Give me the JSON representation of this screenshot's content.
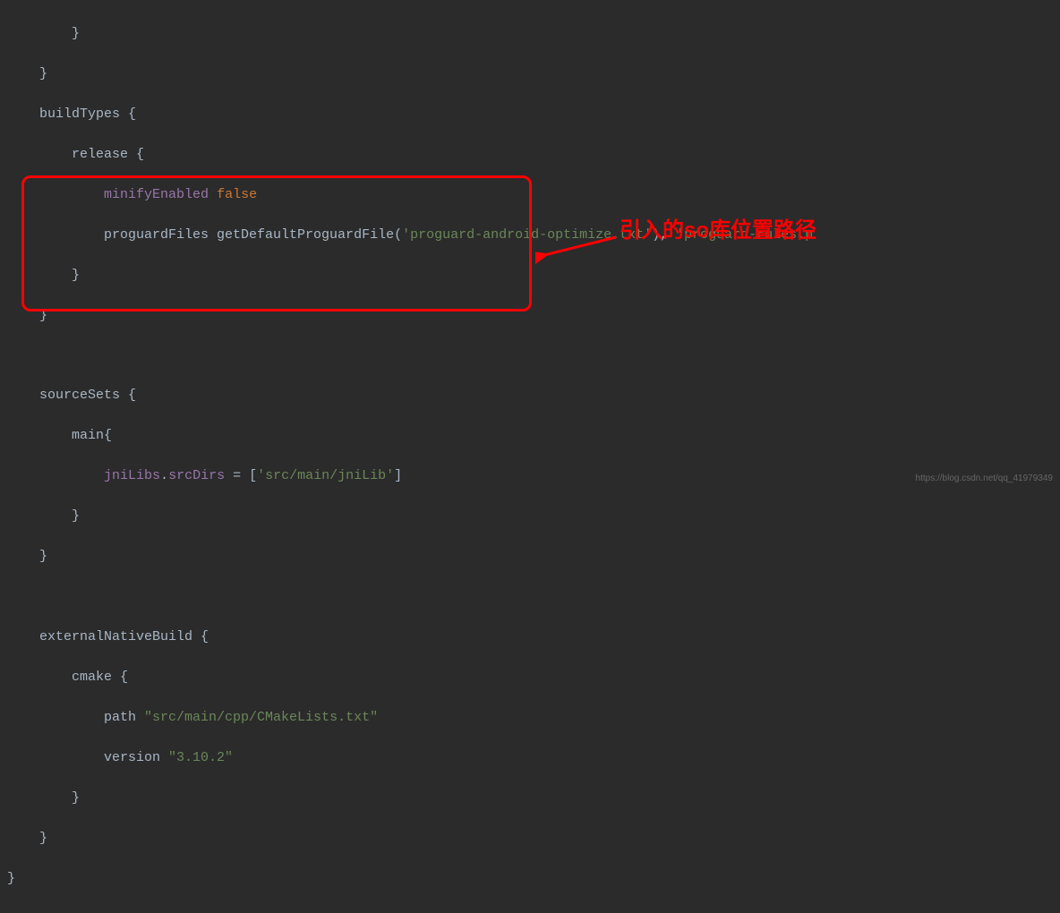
{
  "code": {
    "l1": "        }",
    "l2": "    }",
    "l3_1": "    buildTypes",
    "l3_2": " {",
    "l4_1": "        release",
    "l4_2": " {",
    "l5_1": "            ",
    "l5_prop": "minifyEnabled",
    "l5_sp": " ",
    "l5_bool": "false",
    "l6_1": "            proguardFiles getDefaultProguardFile(",
    "l6_str1": "'proguard-android-optimize.txt'",
    "l6_2": "), ",
    "l6_str2": "'proguard-rules.p",
    "l7": "        }",
    "l8": "    }",
    "l9": "",
    "l10_1": "    sourceSets",
    "l10_2": " {",
    "l11_1": "        main",
    "l11_2": "{",
    "l12_1": "            ",
    "l12_prop": "jniLibs",
    "l12_2": ".",
    "l12_prop2": "srcDirs",
    "l12_3": " = [",
    "l12_str": "'src/main/jniLib'",
    "l12_4": "]",
    "l13": "        }",
    "l14": "    }",
    "l15": "",
    "l16_1": "    externalNativeBuild",
    "l16_2": " {",
    "l17_1": "        cmake",
    "l17_2": " {",
    "l18_1": "            path ",
    "l18_str": "\"src/main/cpp/CMakeLists.txt\"",
    "l19_1": "            version ",
    "l19_str": "\"3.10.2\"",
    "l20": "        }",
    "l21": "    }",
    "l22": "}"
  },
  "annotation": "引入的so库位置路径",
  "watermark": "https://blog.csdn.net/qq_41979349"
}
